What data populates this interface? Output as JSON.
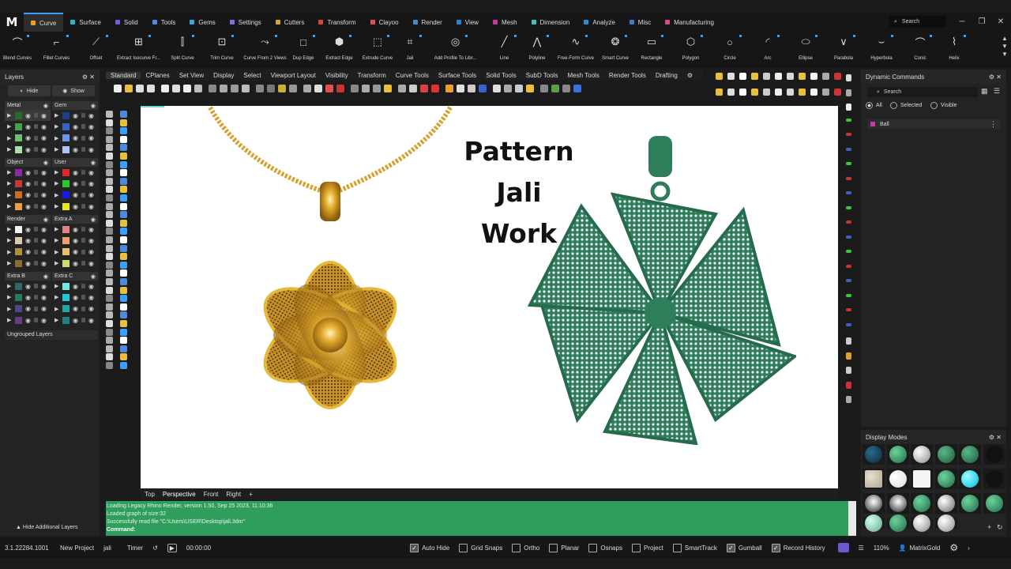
{
  "menubar": {
    "logo": "M",
    "tabs": [
      {
        "label": "Curve",
        "color": "#e8a21b",
        "active": true
      },
      {
        "label": "Surface",
        "color": "#2bb3c9"
      },
      {
        "label": "Solid",
        "color": "#7a5be0"
      },
      {
        "label": "Tools",
        "color": "#4a8ae0"
      },
      {
        "label": "Gems",
        "color": "#3aa6d9"
      },
      {
        "label": "Settings",
        "color": "#8a6ad8"
      },
      {
        "label": "Cutters",
        "color": "#e0a128"
      },
      {
        "label": "Transform",
        "color": "#d9482b"
      },
      {
        "label": "Clayoo",
        "color": "#e05050"
      },
      {
        "label": "Render",
        "color": "#3b8ed6"
      },
      {
        "label": "View",
        "color": "#2d7fd0"
      },
      {
        "label": "Mesh",
        "color": "#c33aa2"
      },
      {
        "label": "Dimension",
        "color": "#3cc4b8"
      },
      {
        "label": "Analyze",
        "color": "#2f8ad5"
      },
      {
        "label": "Misc",
        "color": "#3b7bd0"
      },
      {
        "label": "Manufacturing",
        "color": "#d84a8a"
      }
    ],
    "search_placeholder": "Search"
  },
  "ribbon": [
    {
      "label": "Blend Curves",
      "icon": "blend-curves-icon"
    },
    {
      "label": "Fillet Curves",
      "icon": "fillet-curves-icon"
    },
    {
      "label": "Offset",
      "icon": "offset-icon"
    },
    {
      "label": "Extract Isocurve Fr...",
      "icon": "extract-isocurve-icon"
    },
    {
      "label": "Split Curve",
      "icon": "split-curve-icon"
    },
    {
      "label": "Trim Curve",
      "icon": "trim-curve-icon"
    },
    {
      "label": "Curve From 2 Views",
      "icon": "curve-from-2-views-icon"
    },
    {
      "label": "Dup Edge",
      "icon": "dup-edge-icon"
    },
    {
      "label": "Extract Edge",
      "icon": "extract-edge-icon"
    },
    {
      "label": "Extrude Curve",
      "icon": "extrude-curve-icon"
    },
    {
      "label": "Jali",
      "icon": "jali-icon"
    },
    {
      "label": "Add Profile To Libr...",
      "icon": "add-profile-icon"
    },
    {
      "label": "Line",
      "icon": "line-icon"
    },
    {
      "label": "Polyline",
      "icon": "polyline-icon"
    },
    {
      "label": "Free-Form Curve",
      "icon": "free-form-curve-icon"
    },
    {
      "label": "Smart Curve",
      "icon": "smart-curve-icon"
    },
    {
      "label": "Rectangle",
      "icon": "rectangle-icon"
    },
    {
      "label": "Polygon",
      "icon": "polygon-icon"
    },
    {
      "label": "Circle",
      "icon": "circle-icon"
    },
    {
      "label": "Arc",
      "icon": "arc-icon"
    },
    {
      "label": "Ellipse",
      "icon": "ellipse-icon"
    },
    {
      "label": "Parabola",
      "icon": "parabola-icon"
    },
    {
      "label": "Hyperbola",
      "icon": "hyperbola-icon"
    },
    {
      "label": "Conic",
      "icon": "conic-icon"
    },
    {
      "label": "Helix",
      "icon": "helix-icon"
    }
  ],
  "layers": {
    "title": "Layers",
    "hide_label": "Hide",
    "show_label": "Show",
    "groups": [
      {
        "name": "Metal",
        "colors": [
          "#2a6a2a",
          "#4aa04a",
          "#6fc06f",
          "#a8e0a8"
        ]
      },
      {
        "name": "Gem",
        "colors": [
          "#1d3f8f",
          "#3564c8",
          "#6a96e8",
          "#a9c6f4"
        ]
      },
      {
        "name": "Object",
        "colors": [
          "#8a2aa0",
          "#c0393b",
          "#d06a2a",
          "#e8a040"
        ]
      },
      {
        "name": "User",
        "colors": [
          "#e02828",
          "#28c828",
          "#1a1ae8",
          "#e8e820"
        ]
      },
      {
        "name": "Render",
        "colors": [
          "#f4f4f4",
          "#d8cbb0",
          "#b09040",
          "#8a6a30"
        ]
      },
      {
        "name": "Extra A",
        "colors": [
          "#e88080",
          "#e8a070",
          "#e8c070",
          "#d0d870"
        ]
      },
      {
        "name": "Extra B",
        "colors": [
          "#2a6a6a",
          "#2a7a5a",
          "#4a4a8a",
          "#6a3a8a"
        ]
      },
      {
        "name": "Extra C",
        "colors": [
          "#70e8e8",
          "#20c8d8",
          "#20a8a8",
          "#208080"
        ]
      }
    ],
    "ungrouped_label": "Ungrouped Layers",
    "hide_additional_label": "Hide Additional Layers"
  },
  "subtabs": [
    "Standard",
    "CPlanes",
    "Set View",
    "Display",
    "Select",
    "Viewport Layout",
    "Visibility",
    "Transform",
    "Curve Tools",
    "Surface Tools",
    "Solid Tools",
    "SubD Tools",
    "Mesh Tools",
    "Render Tools",
    "Drafting"
  ],
  "viewport": {
    "title_line1": "Pattern Jali",
    "title_line2": "Work",
    "tabs": [
      "Top",
      "Perspective",
      "Front",
      "Right"
    ],
    "add_tab": "+"
  },
  "command_history": [
    "Loading Legacy Rhino Render, version 1.50, Sep 25 2023, 11:10:36",
    "Loaded graph of size:32",
    "Successfully read file \"C:\\Users\\USER\\Desktop\\jali.3dm\""
  ],
  "command_prompt": "Command:",
  "dynamic_commands": {
    "title": "Dynamic Commands",
    "search_placeholder": "Search",
    "filters": [
      "All",
      "Selected",
      "Visible"
    ],
    "items": [
      "Ball"
    ]
  },
  "display_modes": {
    "title": "Display Modes"
  },
  "status": {
    "version": "3.1.22284.1001",
    "project_button": "New Project",
    "project_name": "jali",
    "timer_label": "Timer",
    "timer_value": "00:00:00",
    "toggles": [
      {
        "label": "Auto Hide",
        "checked": true
      },
      {
        "label": "Grid Snaps",
        "checked": false
      },
      {
        "label": "Ortho",
        "checked": false
      },
      {
        "label": "Planar",
        "checked": false
      },
      {
        "label": "Osnaps",
        "checked": false
      },
      {
        "label": "Project",
        "checked": false
      },
      {
        "label": "SmartTrack",
        "checked": false
      },
      {
        "label": "Gumball",
        "checked": true
      },
      {
        "label": "Record History",
        "checked": true
      }
    ],
    "zoom": "110%",
    "brand": "MatrixGold"
  },
  "colors": {
    "accent": "#3aa0ff",
    "command_bg": "#2f9e5c",
    "gold": "#d9a520",
    "jali_green": "#2e7d5b"
  }
}
